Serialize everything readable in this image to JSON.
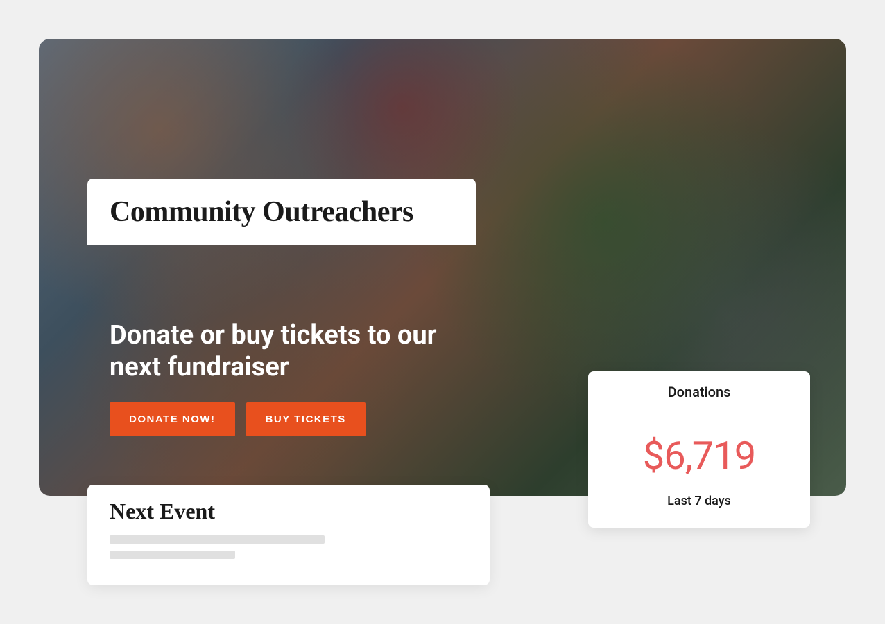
{
  "brand": {
    "title": "Community Outreachers"
  },
  "cta": {
    "headline": "Donate or buy tickets to our next fundraiser",
    "donate_button": "DONATE NOW!",
    "tickets_button": "BUY TICKETS"
  },
  "next_event": {
    "title": "Next Event"
  },
  "donations": {
    "header": "Donations",
    "amount": "$6,719",
    "period": "Last 7 days"
  },
  "colors": {
    "accent": "#e8501e",
    "amount": "#e85a5a"
  }
}
